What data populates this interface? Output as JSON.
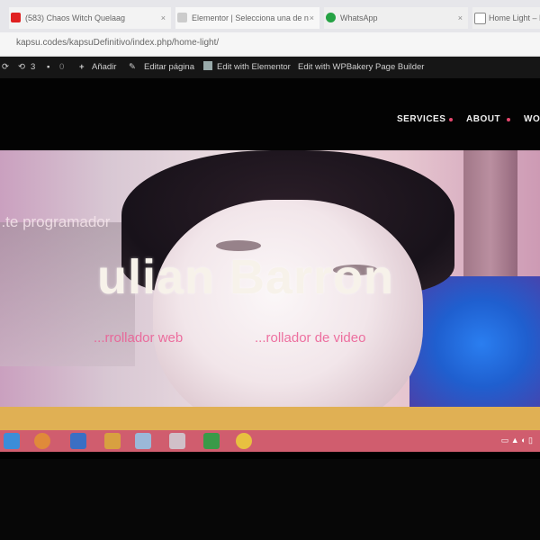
{
  "browser": {
    "tabs": [
      {
        "label": "(583) Chaos Witch Quelaag",
        "icon_color": "#e02020"
      },
      {
        "label": "Elementor | Selecciona una de n",
        "icon_color": "#cccccc"
      },
      {
        "label": "WhatsApp",
        "icon_color": "#25a244"
      },
      {
        "label": "Home Light – K",
        "icon_color": "#888888"
      }
    ],
    "close_glyph": "×",
    "url": "kapsu.codes/kapsuDefinitivo/index.php/home-light/"
  },
  "adminbar": {
    "updates_count": "3",
    "comments_count": "0",
    "new_label": "Añadir",
    "edit_page_label": "Editar página",
    "elementor_label": "Edit with Elementor",
    "wpbakery_label": "Edit with WPBakery Page Builder"
  },
  "site": {
    "nav": [
      "SERVICES",
      "ABOUT",
      "WO"
    ]
  },
  "hero": {
    "subtitle": "...te programador",
    "name": "ulian Barron",
    "role_1": "...rrollador web",
    "role_2": "...rollador de video"
  },
  "colors": {
    "accent": "#e5476d",
    "taskbar": "#d05d6e",
    "strip": "#e0b054"
  }
}
